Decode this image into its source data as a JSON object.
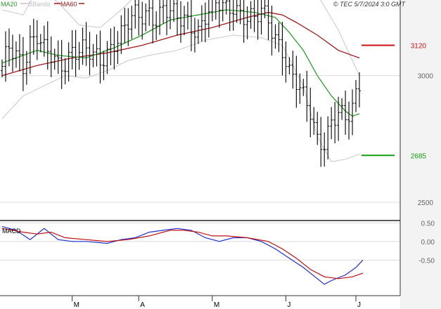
{
  "header": {
    "copyright": "© TEC 5/7/2024 3:0 GMT",
    "legend": [
      {
        "key": "ma20",
        "label": "MA20",
        "color": "#2a9d2a"
      },
      {
        "key": "bbands",
        "label": "BBands",
        "color": "#c0c0c0"
      },
      {
        "key": "ma60",
        "label": "MA60",
        "color": "#a01818"
      }
    ]
  },
  "colors": {
    "panel_bg": "#ffffff",
    "axis_bg": "#f3f3f3",
    "grid": "#dcdcdc",
    "price_bar": "#000000",
    "ma20": "#2a9d2a",
    "ma60": "#a01818",
    "bbands": "#c8c8c8",
    "macd": "#1c2fd0",
    "signal": "#c01010",
    "resistance": "#d01010",
    "support": "#10a010"
  },
  "chart_data": [
    {
      "type": "ohlc",
      "ylim": [
        24.5,
        32.6
      ],
      "yticks": [
        {
          "value": 25,
          "label": "2500"
        },
        {
          "value": 30,
          "label": "3000"
        }
      ],
      "x_labels": [
        {
          "index": 20,
          "label": "M"
        },
        {
          "index": 39,
          "label": "A"
        },
        {
          "index": 60,
          "label": "M"
        },
        {
          "index": 81,
          "label": "J"
        },
        {
          "index": 101,
          "label": "J"
        }
      ],
      "levels": [
        {
          "name": "resistance",
          "value": 31.2,
          "label": "3120",
          "color": "#d01010"
        },
        {
          "name": "support",
          "value": 26.85,
          "label": "2685",
          "color": "#10a010"
        }
      ],
      "anchors": [
        [
          0,
          30.2
        ],
        [
          2,
          31.0
        ],
        [
          4,
          30.8
        ],
        [
          6,
          30.5
        ],
        [
          8,
          31.4
        ],
        [
          10,
          31.6
        ],
        [
          12,
          30.9
        ],
        [
          14,
          30.7
        ],
        [
          16,
          30.4
        ],
        [
          18,
          30.6
        ],
        [
          20,
          31.1
        ],
        [
          22,
          31.0
        ],
        [
          24,
          30.9
        ],
        [
          26,
          30.7
        ],
        [
          28,
          30.6
        ],
        [
          30,
          31.0
        ],
        [
          32,
          31.4
        ],
        [
          34,
          31.6
        ],
        [
          36,
          32.0
        ],
        [
          38,
          32.3
        ],
        [
          40,
          32.4
        ],
        [
          42,
          32.6
        ],
        [
          44,
          32.3
        ],
        [
          46,
          32.6
        ],
        [
          48,
          32.4
        ],
        [
          50,
          32.2
        ],
        [
          52,
          32.3
        ],
        [
          54,
          32.1
        ],
        [
          56,
          31.8
        ],
        [
          58,
          32.3
        ],
        [
          60,
          32.6
        ],
        [
          62,
          32.8
        ],
        [
          64,
          32.7
        ],
        [
          66,
          32.9
        ],
        [
          68,
          32.5
        ],
        [
          70,
          32.2
        ],
        [
          72,
          32.1
        ],
        [
          74,
          32.5
        ],
        [
          76,
          32.3
        ],
        [
          78,
          31.6
        ],
        [
          80,
          31.1
        ],
        [
          82,
          30.0
        ],
        [
          84,
          29.6
        ],
        [
          86,
          29.1
        ],
        [
          88,
          28.7
        ],
        [
          90,
          27.6
        ],
        [
          92,
          27.4
        ],
        [
          94,
          28.0
        ],
        [
          96,
          28.4
        ],
        [
          98,
          28.2
        ],
        [
          100,
          28.9
        ],
        [
          102,
          29.8
        ]
      ],
      "ma20": [
        [
          0,
          30.5
        ],
        [
          10,
          31.0
        ],
        [
          16,
          30.8
        ],
        [
          24,
          30.7
        ],
        [
          32,
          31.1
        ],
        [
          40,
          31.6
        ],
        [
          48,
          32.2
        ],
        [
          56,
          32.4
        ],
        [
          64,
          32.6
        ],
        [
          72,
          32.5
        ],
        [
          78,
          32.3
        ],
        [
          82,
          31.7
        ],
        [
          86,
          31.0
        ],
        [
          90,
          30.0
        ],
        [
          94,
          29.2
        ],
        [
          98,
          28.6
        ],
        [
          100,
          28.4
        ],
        [
          102,
          28.5
        ]
      ],
      "ma60": [
        [
          0,
          30.0
        ],
        [
          10,
          30.4
        ],
        [
          20,
          30.7
        ],
        [
          30,
          30.9
        ],
        [
          40,
          31.2
        ],
        [
          50,
          31.6
        ],
        [
          60,
          31.9
        ],
        [
          70,
          32.3
        ],
        [
          76,
          32.5
        ],
        [
          80,
          32.4
        ],
        [
          84,
          32.1
        ],
        [
          90,
          31.6
        ],
        [
          96,
          31.0
        ],
        [
          102,
          30.7
        ]
      ],
      "bb_upper": [
        [
          0,
          32.6
        ],
        [
          6,
          32.4
        ],
        [
          10,
          33.4
        ],
        [
          16,
          32.9
        ],
        [
          22,
          32.0
        ],
        [
          28,
          31.9
        ],
        [
          34,
          32.6
        ],
        [
          40,
          33.4
        ],
        [
          48,
          33.6
        ],
        [
          56,
          33.5
        ],
        [
          64,
          33.4
        ],
        [
          72,
          33.3
        ],
        [
          78,
          33.2
        ],
        [
          84,
          33.3
        ],
        [
          90,
          33.2
        ],
        [
          96,
          31.8
        ],
        [
          100,
          30.6
        ],
        [
          102,
          30.0
        ]
      ],
      "bb_lower": [
        [
          0,
          28.3
        ],
        [
          6,
          29.2
        ],
        [
          12,
          29.6
        ],
        [
          18,
          30.0
        ],
        [
          24,
          29.9
        ],
        [
          30,
          30.2
        ],
        [
          36,
          30.6
        ],
        [
          42,
          30.8
        ],
        [
          50,
          31.0
        ],
        [
          58,
          31.4
        ],
        [
          66,
          31.6
        ],
        [
          74,
          31.5
        ],
        [
          80,
          31.2
        ],
        [
          86,
          29.6
        ],
        [
          90,
          27.6
        ],
        [
          94,
          26.6
        ],
        [
          98,
          26.7
        ],
        [
          102,
          26.9
        ]
      ],
      "n_bars": 103
    },
    {
      "type": "line",
      "name": "MACD",
      "ylim": [
        -1.4,
        0.45
      ],
      "yticks": [
        {
          "value": 0.5,
          "label": "0.50"
        },
        {
          "value": 0,
          "label": "0.00"
        },
        {
          "value": -0.5,
          "label": "-0.50"
        }
      ],
      "series": [
        {
          "key": "macd",
          "values": [
            [
              0,
              0.4
            ],
            [
              4,
              0.3
            ],
            [
              8,
              0.05
            ],
            [
              12,
              0.35
            ],
            [
              16,
              0.05
            ],
            [
              20,
              0.0
            ],
            [
              24,
              0.0
            ],
            [
              30,
              -0.05
            ],
            [
              34,
              0.05
            ],
            [
              38,
              0.1
            ],
            [
              42,
              0.25
            ],
            [
              46,
              0.3
            ],
            [
              50,
              0.35
            ],
            [
              54,
              0.3
            ],
            [
              58,
              0.1
            ],
            [
              62,
              0.0
            ],
            [
              66,
              0.1
            ],
            [
              70,
              0.1
            ],
            [
              74,
              0.0
            ],
            [
              78,
              -0.2
            ],
            [
              82,
              -0.45
            ],
            [
              86,
              -0.7
            ],
            [
              90,
              -1.0
            ],
            [
              92,
              -1.15
            ],
            [
              94,
              -1.05
            ],
            [
              98,
              -0.9
            ],
            [
              101,
              -0.7
            ],
            [
              103,
              -0.5
            ]
          ]
        },
        {
          "key": "signal",
          "values": [
            [
              0,
              0.35
            ],
            [
              6,
              0.25
            ],
            [
              10,
              0.2
            ],
            [
              14,
              0.25
            ],
            [
              18,
              0.1
            ],
            [
              24,
              0.05
            ],
            [
              30,
              0.0
            ],
            [
              36,
              0.05
            ],
            [
              42,
              0.15
            ],
            [
              48,
              0.3
            ],
            [
              52,
              0.3
            ],
            [
              56,
              0.25
            ],
            [
              60,
              0.15
            ],
            [
              64,
              0.15
            ],
            [
              70,
              0.1
            ],
            [
              76,
              0.0
            ],
            [
              80,
              -0.2
            ],
            [
              84,
              -0.45
            ],
            [
              88,
              -0.75
            ],
            [
              92,
              -0.95
            ],
            [
              96,
              -1.0
            ],
            [
              100,
              -0.95
            ],
            [
              103,
              -0.85
            ]
          ]
        }
      ]
    }
  ]
}
